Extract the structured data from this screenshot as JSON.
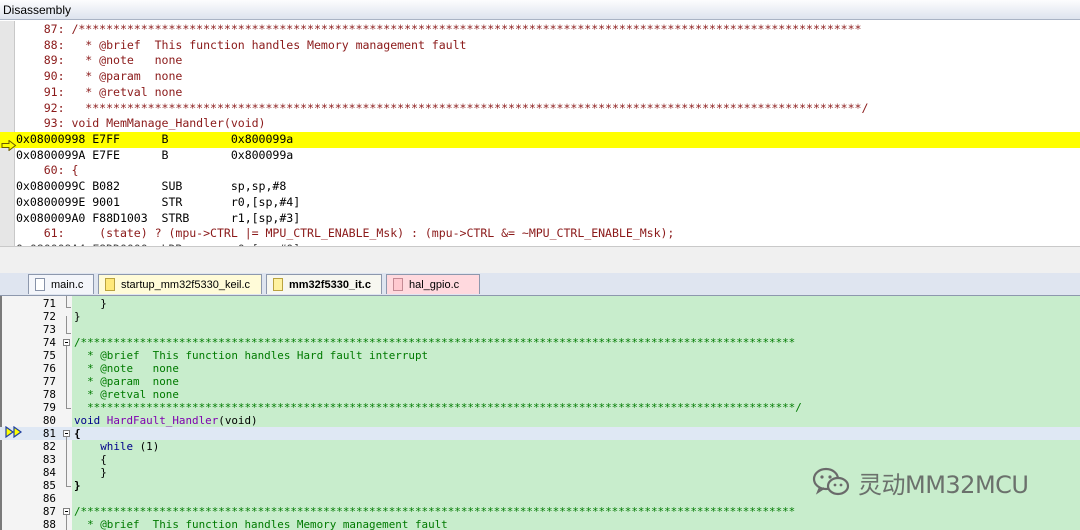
{
  "disassembly": {
    "title": "Disassembly",
    "lines": [
      {
        "text": "    87: /*****************************************************************************************************************",
        "kind": "src"
      },
      {
        "text": "    88:   * @brief  This function handles Memory management fault",
        "kind": "src"
      },
      {
        "text": "    89:   * @note   none",
        "kind": "src"
      },
      {
        "text": "    90:   * @param  none",
        "kind": "src"
      },
      {
        "text": "    91:   * @retval none",
        "kind": "src"
      },
      {
        "text": "    92:   ****************************************************************************************************************/",
        "kind": "src"
      },
      {
        "text": "    93: void MemManage_Handler(void)",
        "kind": "src"
      },
      {
        "text": "0x08000998 E7FF      B         0x800099a",
        "kind": "asm",
        "current": true
      },
      {
        "text": "0x0800099A E7FE      B         0x800099a",
        "kind": "asm"
      },
      {
        "text": "    60: {",
        "kind": "src"
      },
      {
        "text": "0x0800099C B082      SUB       sp,sp,#8",
        "kind": "asm"
      },
      {
        "text": "0x0800099E 9001      STR       r0,[sp,#4]",
        "kind": "asm"
      },
      {
        "text": "0x080009A0 F88D1003  STRB      r1,[sp,#3]",
        "kind": "asm"
      },
      {
        "text": "    61:     (state) ? (mpu->CTRL |= MPU_CTRL_ENABLE_Msk) : (mpu->CTRL &= ~MPU_CTRL_ENABLE_Msk);",
        "kind": "src"
      }
    ]
  },
  "tabs": [
    {
      "label": "main.c",
      "style": "normal"
    },
    {
      "label": "startup_mm32f5330_keil.c",
      "style": "yellow"
    },
    {
      "label": "mm32f5330_it.c",
      "style": "active"
    },
    {
      "label": "hal_gpio.c",
      "style": "pink"
    }
  ],
  "editor": {
    "lines": [
      {
        "num": "71",
        "code": "    }"
      },
      {
        "num": "72",
        "code": "}"
      },
      {
        "num": "73",
        "code": ""
      },
      {
        "num": "74",
        "code": "/*************************************************************************************************************"
      },
      {
        "num": "75",
        "code": "  * @brief  This function handles Hard fault interrupt"
      },
      {
        "num": "76",
        "code": "  * @note   none"
      },
      {
        "num": "77",
        "code": "  * @param  none"
      },
      {
        "num": "78",
        "code": "  * @retval none"
      },
      {
        "num": "79",
        "code": "  ************************************************************************************************************/"
      },
      {
        "num": "80",
        "code_kw": "void ",
        "code_fn": "HardFault_Handler",
        "code_rest": "(void)"
      },
      {
        "num": "81",
        "code": "{"
      },
      {
        "num": "82",
        "code_kw": "    while ",
        "code_rest": "(1)"
      },
      {
        "num": "83",
        "code": "    {"
      },
      {
        "num": "84",
        "code": "    }"
      },
      {
        "num": "85",
        "code": "}"
      },
      {
        "num": "86",
        "code": ""
      },
      {
        "num": "87",
        "code": "/*************************************************************************************************************"
      },
      {
        "num": "88",
        "code": "  * @brief  This function handles Memory management fault"
      }
    ]
  },
  "watermark": {
    "text": "灵动MM32MCU",
    "icon": "wechat-icon"
  },
  "colors": {
    "highlight": "#ffff00",
    "editor_bg": "#c8edcc",
    "comment": "#007a00",
    "source": "#8b1a1a"
  }
}
